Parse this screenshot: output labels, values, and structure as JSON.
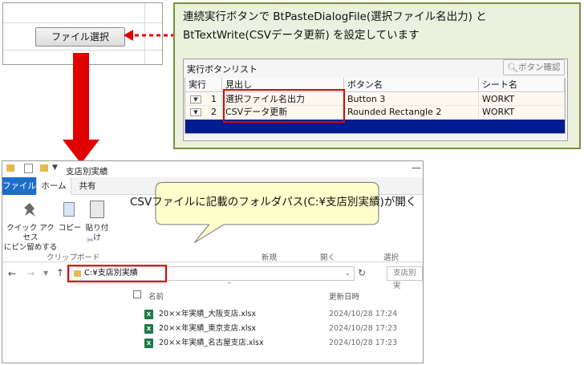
{
  "sheet": {
    "button_label": "ファイル選択"
  },
  "note": {
    "line1": "連続実行ボタンで BtPasteDialogFile(選択ファイル名出力) と",
    "line2": "BtTextWrite(CSVデータ更新) を設定しています"
  },
  "panel": {
    "title": "実行ボタンリスト",
    "search_label": "ボタン確認",
    "columns": [
      "実行",
      "見出し",
      "ボタン名",
      "シート名"
    ],
    "rows": [
      {
        "no": "1",
        "heading": "選択ファイル名出力",
        "button": "Button 3",
        "sheet": "WORKT"
      },
      {
        "no": "2",
        "heading": "CSVデータ更新",
        "button": "Rounded Rectangle 2",
        "sheet": "WORKT"
      }
    ]
  },
  "explorer": {
    "title": "支店別実績",
    "tabs": {
      "file": "ファイル",
      "home": "ホーム",
      "share": "共有"
    },
    "ribbon": {
      "quick_access": "クイック アクセス\nにピン留めする",
      "copy": "コピー",
      "paste": "貼り付け",
      "groups": {
        "clipboard": "クリップボード",
        "new": "新規",
        "open": "開く",
        "select": "選択"
      }
    },
    "address": "C:¥支店別実績",
    "search_placeholder": "支店別実",
    "columns": {
      "name": "名前",
      "modified": "更新日時"
    },
    "files": [
      {
        "name": "20××年実績_大阪支店.xlsx",
        "date": "2024/10/28 17:24"
      },
      {
        "name": "20××年実績_東京支店.xlsx",
        "date": "2024/10/28 17:23"
      },
      {
        "name": "20××年実績_名古屋支店.xlsx",
        "date": "2024/10/28 17:23"
      }
    ]
  },
  "callout": {
    "text": "CSVファイルに記載のフォルダパス(C:¥支店別実績)が開く"
  },
  "colors": {
    "accent_red": "#e00000",
    "note_bg": "#ebf1de",
    "note_border": "#77933c",
    "callout_bg": "#ffffcc",
    "ribbon_file_tab": "#1e6ec8",
    "selection_navy": "#001c8f"
  }
}
